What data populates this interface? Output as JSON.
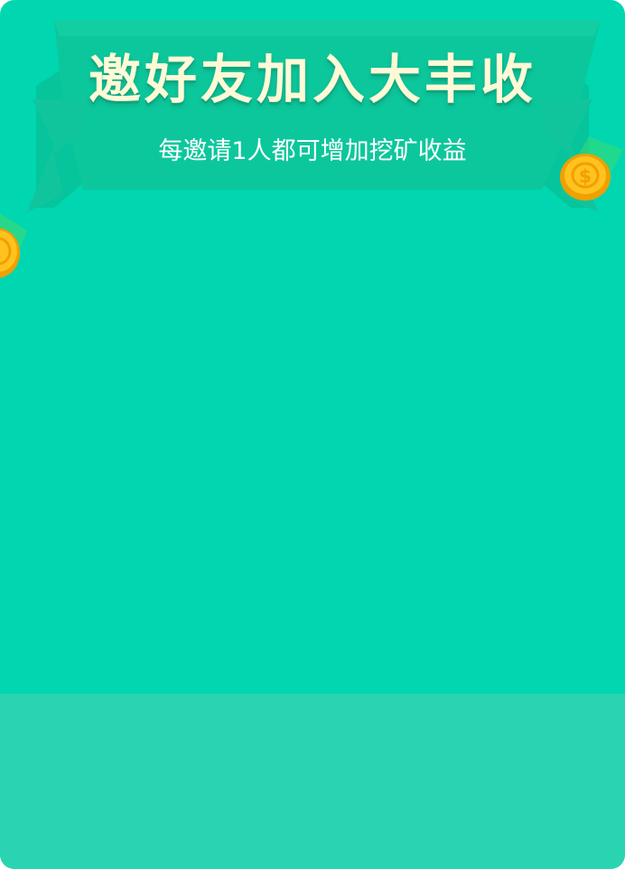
{
  "banner": {
    "title": "邀好友加入大丰收",
    "subtitle": "每邀请1人都可增加挖矿收益"
  },
  "colors": {
    "background": "#00d6b0",
    "bottom_panel": "#2ad4b2",
    "ribbon": "#0cc79c",
    "title_text": "#fff9d6",
    "coin_gold": "#ffb31a"
  },
  "icons": {
    "left_decoration": "gold-coin-icon",
    "right_decoration": "gold-coin-icon"
  }
}
